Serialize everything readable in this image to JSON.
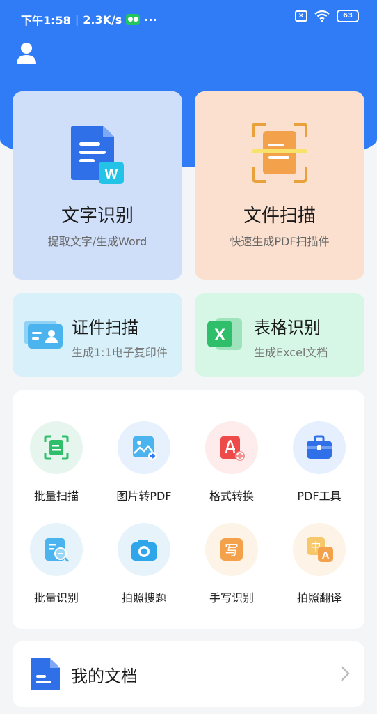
{
  "status": {
    "time": "下午1:58",
    "speed": "2.3K/s",
    "dots": "···",
    "battery": "63"
  },
  "cards": {
    "text_recognition": {
      "title": "文字识别",
      "subtitle": "提取文字/生成Word",
      "badge": "W"
    },
    "doc_scan": {
      "title": "文件扫描",
      "subtitle": "快速生成PDF扫描件"
    },
    "id_scan": {
      "title": "证件扫描",
      "subtitle": "生成1:1电子复印件"
    },
    "table_recognition": {
      "title": "表格识别",
      "subtitle": "生成Excel文档",
      "badge": "X"
    }
  },
  "tools": [
    {
      "label": "批量扫描",
      "icon": "batch-scan-icon",
      "color": "#e6f6ef"
    },
    {
      "label": "图片转PDF",
      "icon": "image-to-pdf-icon",
      "color": "#e6f1fd"
    },
    {
      "label": "格式转换",
      "icon": "format-convert-icon",
      "color": "#fdeceb"
    },
    {
      "label": "PDF工具",
      "icon": "pdf-tools-icon",
      "color": "#e6effd"
    },
    {
      "label": "批量识别",
      "icon": "batch-recognize-icon",
      "color": "#e6f3fb"
    },
    {
      "label": "拍照搜题",
      "icon": "photo-search-icon",
      "color": "#e6f3fb"
    },
    {
      "label": "手写识别",
      "icon": "handwriting-icon",
      "color": "#fdf3e6",
      "glyph": "写"
    },
    {
      "label": "拍照翻译",
      "icon": "photo-translate-icon",
      "color": "#fdf3e6",
      "glyph_a": "中",
      "glyph_b": "A"
    }
  ],
  "my_docs": {
    "label": "我的文档"
  },
  "colors": {
    "accent": "#2f7cf6"
  }
}
